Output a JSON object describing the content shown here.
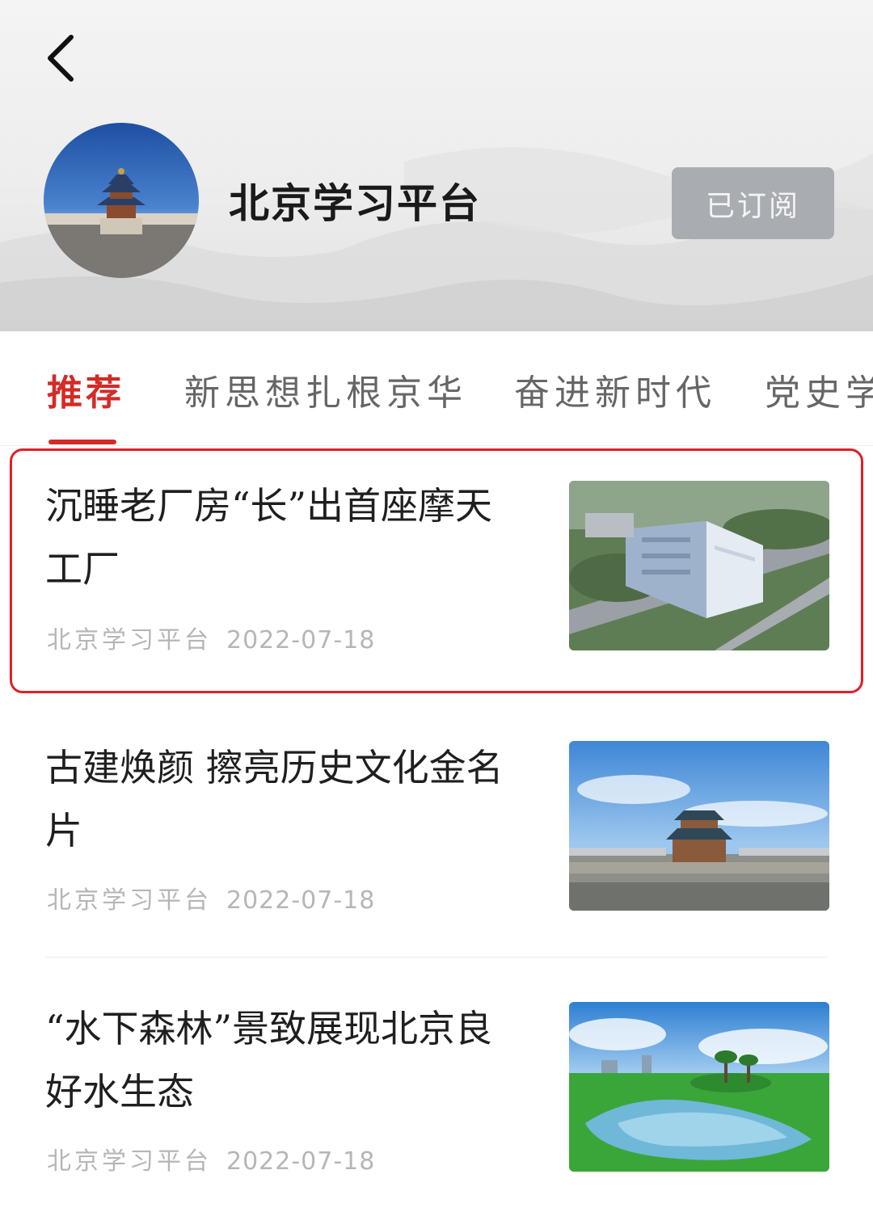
{
  "header": {
    "channel_title": "北京学习平台",
    "subscribe_label": "已订阅"
  },
  "tabs": [
    {
      "label": "推荐",
      "active": true
    },
    {
      "label": "新思想扎根京华",
      "active": false
    },
    {
      "label": "奋进新时代",
      "active": false
    },
    {
      "label": "党史学",
      "active": false
    }
  ],
  "articles": [
    {
      "title": "沉睡老厂房“长”出首座摩天工厂",
      "source": "北京学习平台",
      "date": "2022-07-18",
      "image": "aerial-factory-building"
    },
    {
      "title": "古建焕颜 擦亮历史文化金名片",
      "source": "北京学习平台",
      "date": "2022-07-18",
      "image": "gate-tower-blue-sky"
    },
    {
      "title": "“水下森林”景致展现北京良好水生态",
      "source": "北京学习平台",
      "date": "2022-07-18",
      "image": "lake-green-park"
    }
  ],
  "colors": {
    "accent": "#d32b27",
    "highlight_border": "#e01e2a",
    "subscribe_bg": "#a9adb2"
  }
}
